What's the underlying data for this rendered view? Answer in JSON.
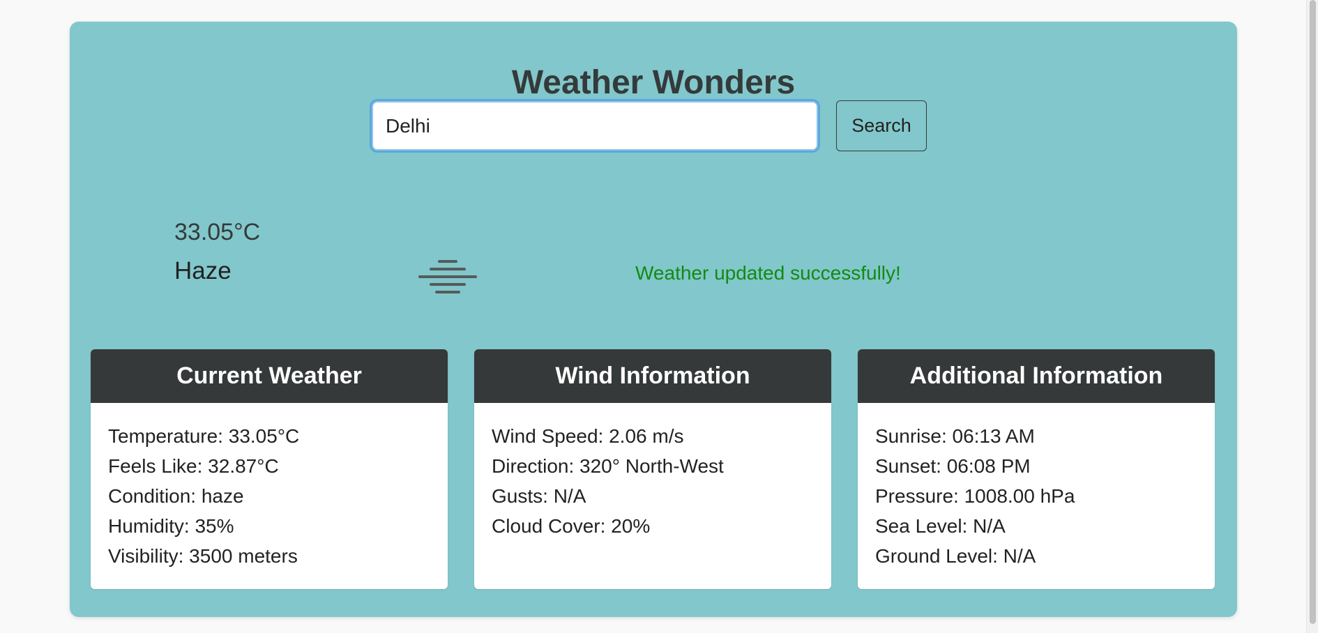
{
  "app": {
    "title": "Weather Wonders",
    "background_color": "#82c7cb"
  },
  "search": {
    "value": "Delhi",
    "button_label": "Search"
  },
  "summary": {
    "icon": "haze-icon",
    "temperature": "33.05°C",
    "condition": "Haze",
    "status_message": "Weather updated successfully!",
    "status_color": "#128a12"
  },
  "cards": [
    {
      "title": "Current Weather",
      "lines": [
        "Temperature: 33.05°C",
        "Feels Like: 32.87°C",
        "Condition: haze",
        "Humidity: 35%",
        "Visibility: 3500 meters"
      ]
    },
    {
      "title": "Wind Information",
      "lines": [
        "Wind Speed: 2.06 m/s",
        "Direction: 320° North-West",
        "Gusts: N/A",
        "Cloud Cover: 20%"
      ]
    },
    {
      "title": "Additional Information",
      "lines": [
        "Sunrise: 06:13 AM",
        "Sunset: 06:08 PM",
        "Pressure: 1008.00 hPa",
        "Sea Level: N/A",
        "Ground Level: N/A"
      ]
    }
  ]
}
